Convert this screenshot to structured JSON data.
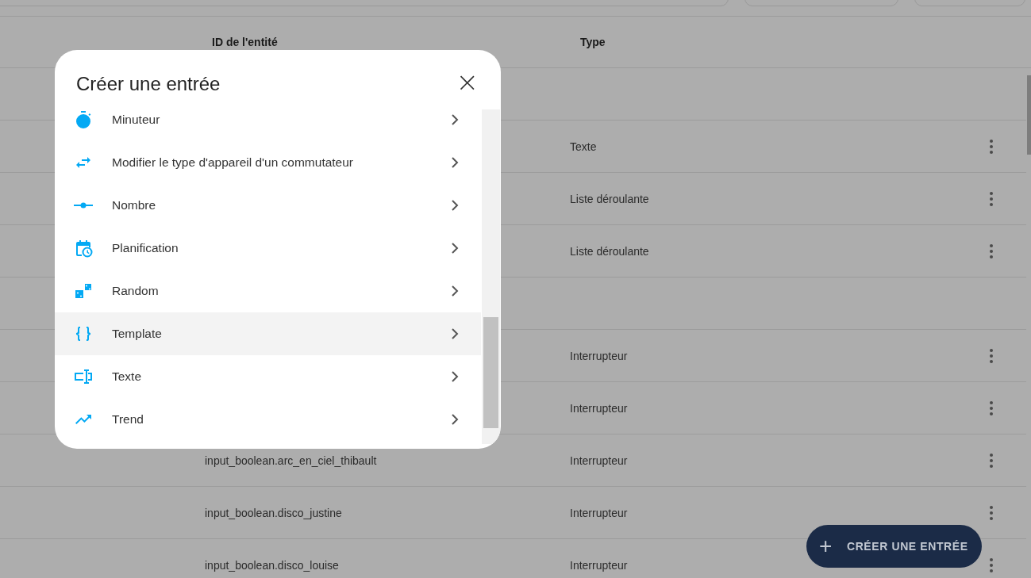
{
  "table": {
    "columns": [
      "ID de l'entité",
      "Type"
    ],
    "rows": [
      {
        "kind": "group"
      },
      {
        "kind": "entity",
        "type": "Texte"
      },
      {
        "kind": "entity",
        "type": "Liste déroulante"
      },
      {
        "kind": "entity",
        "type": "Liste déroulante"
      },
      {
        "kind": "group"
      },
      {
        "kind": "entity",
        "type": "Interrupteur"
      },
      {
        "kind": "entity",
        "type": "Interrupteur"
      },
      {
        "kind": "entity",
        "entity_id": "input_boolean.arc_en_ciel_thibault",
        "type": "Interrupteur"
      },
      {
        "kind": "entity",
        "entity_id": "input_boolean.disco_justine",
        "type": "Interrupteur"
      },
      {
        "kind": "entity",
        "entity_id": "input_boolean.disco_louise",
        "type": "Interrupteur"
      }
    ]
  },
  "dialog": {
    "title": "Créer une entrée",
    "close": "×",
    "items": [
      {
        "kind": "timer",
        "label": "Minuteur",
        "selected": false
      },
      {
        "kind": "swap",
        "label": "Modifier le type d'appareil d'un commutateur",
        "selected": false
      },
      {
        "kind": "slider",
        "label": "Nombre",
        "selected": false
      },
      {
        "kind": "schedule",
        "label": "Planification",
        "selected": false
      },
      {
        "kind": "dice",
        "label": "Random",
        "selected": false
      },
      {
        "kind": "braces",
        "label": "Template",
        "selected": true
      },
      {
        "kind": "textbox",
        "label": "Texte",
        "selected": false
      },
      {
        "kind": "trend",
        "label": "Trend",
        "selected": false
      }
    ]
  },
  "fab": {
    "icon": "+",
    "label": "CRÉER UNE ENTRÉE"
  }
}
